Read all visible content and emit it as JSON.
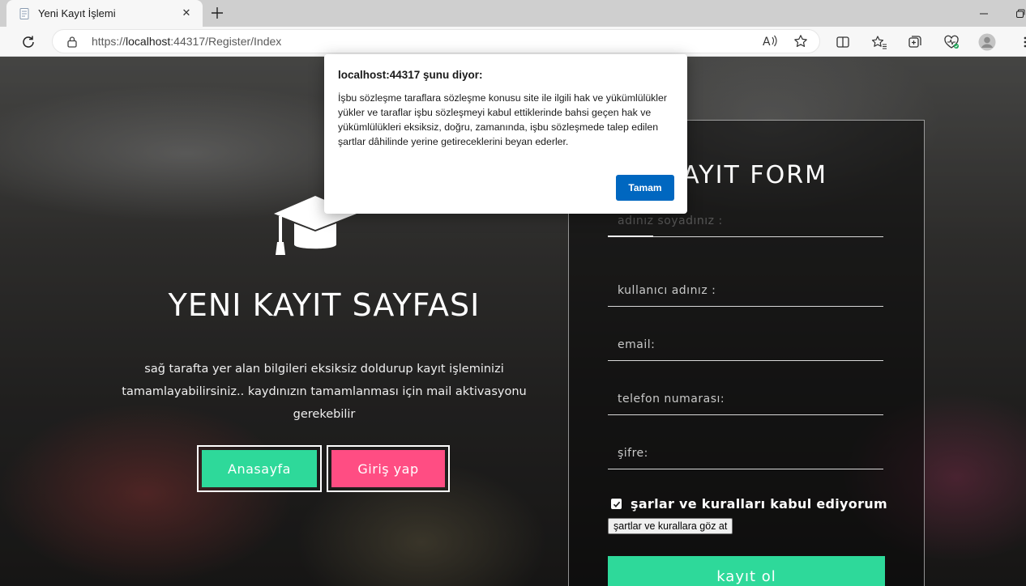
{
  "browser": {
    "tab_title": "Yeni Kayıt İşlemi",
    "url_prefix": "https://",
    "url_host": "localhost",
    "url_rest": ":44317/Register/Index"
  },
  "hero": {
    "title": "YENI KAYIT SAYFASI",
    "description": "sağ tarafta yer alan bilgileri eksiksiz doldurup kayıt işleminizi tamamlayabilirsiniz.. kaydınızın tamamlanması için mail aktivasyonu gerekebilir",
    "home_button": "Anasayfa",
    "login_button": "Giriş yap"
  },
  "form": {
    "title": "KAYIT FORM",
    "fields": {
      "fullname_placeholder": "adınız soyadınız :",
      "username_placeholder": "kullanıcı adınız :",
      "email_placeholder": "email:",
      "phone_placeholder": "telefon numarası:",
      "password_placeholder": "şifre:"
    },
    "terms_checked": true,
    "terms_label": "şarlar ve kuralları kabul ediyorum",
    "rules_button": "şartlar ve kurallara göz at",
    "submit_button": "kayıt ol"
  },
  "dialog": {
    "title": "localhost:44317 şunu diyor:",
    "message": "İşbu sözleşme taraflara sözleşme konusu site ile ilgili hak ve yükümlülükler yükler ve taraflar işbu sözleşmeyi kabul ettiklerinde bahsi geçen hak ve yükümlülükleri eksiksiz, doğru, zamanında, işbu sözleşmede talep edilen şartlar dâhilinde yerine getireceklerini beyan ederler.",
    "ok_button": "Tamam"
  },
  "colors": {
    "accent_green": "#2ed99a",
    "accent_pink": "#ff4d83",
    "dialog_button": "#0067c0"
  }
}
